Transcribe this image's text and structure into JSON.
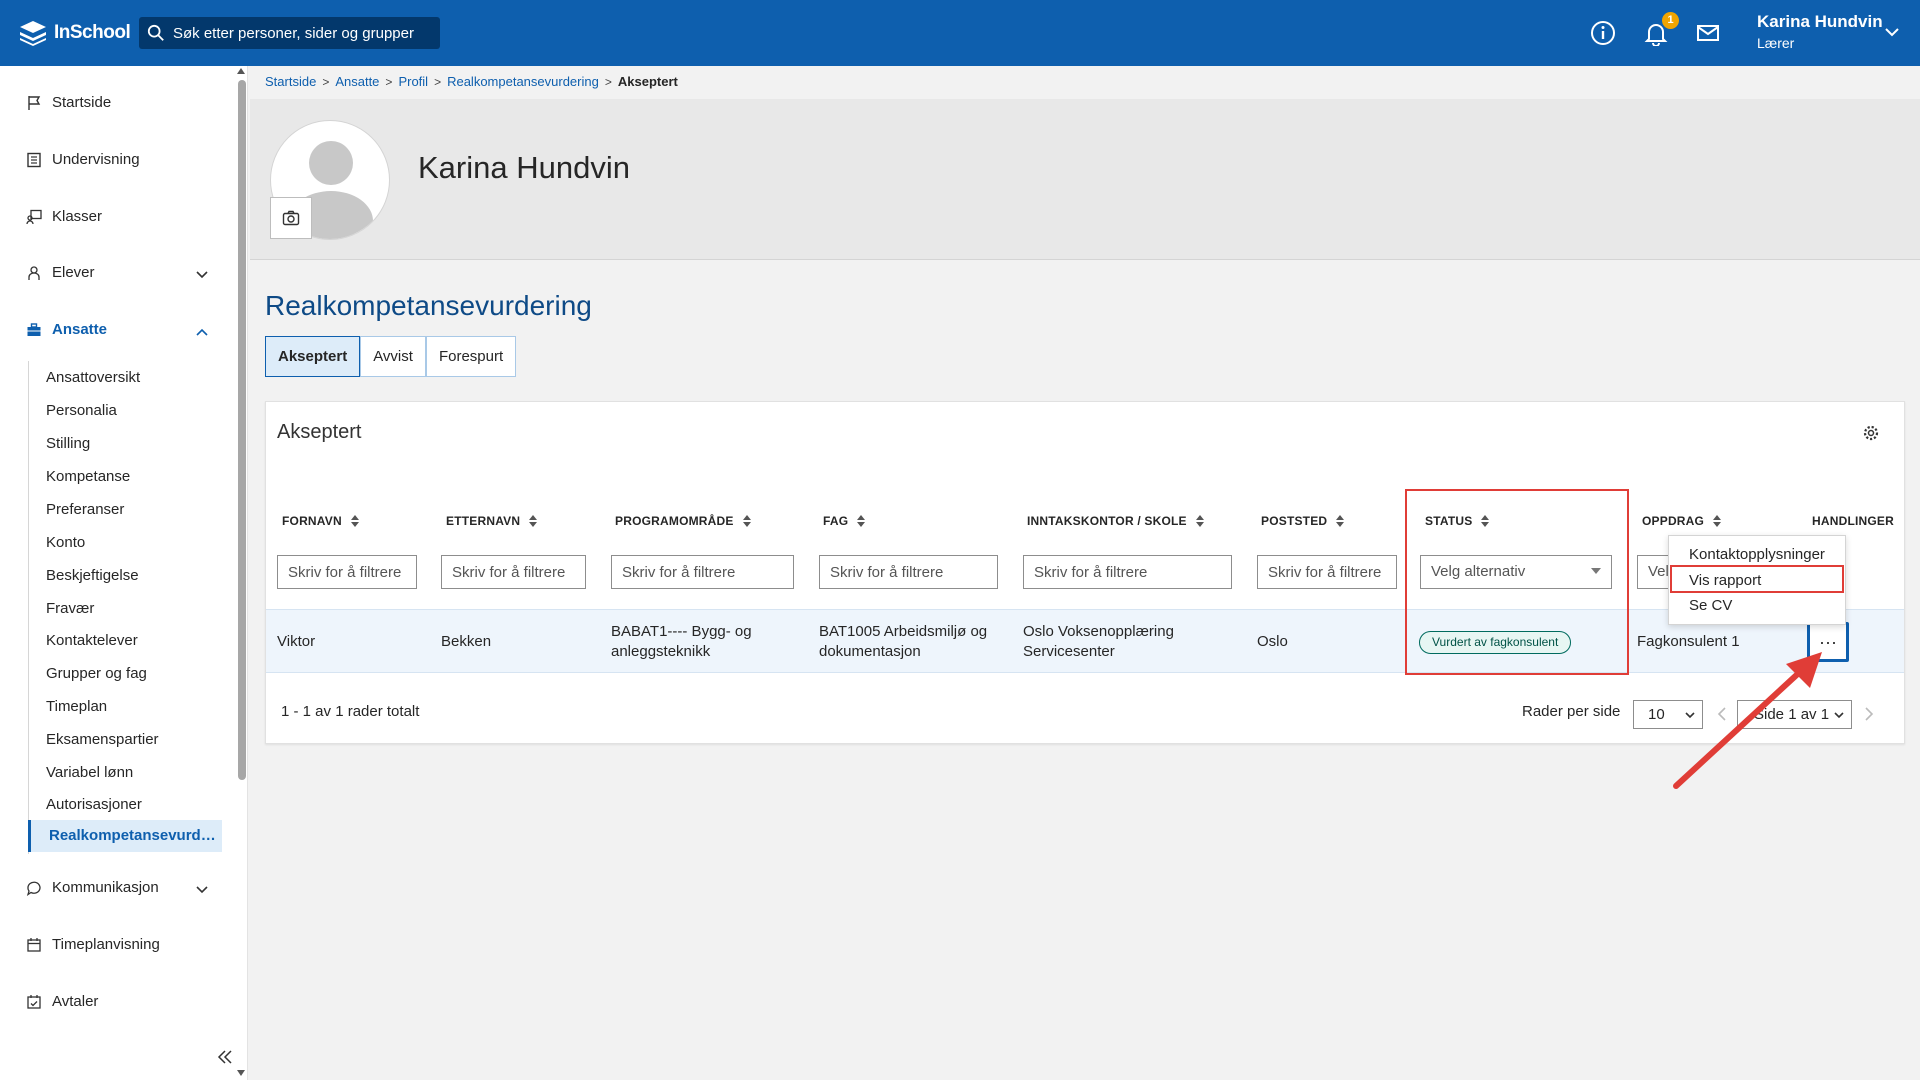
{
  "app": {
    "logo_text": "InSchool",
    "brand_color": "#0e5fae"
  },
  "search": {
    "placeholder": "Søk etter personer, sider og grupper"
  },
  "header": {
    "notification_count": "1",
    "user_name": "Karina Hundvin",
    "user_role": "Lærer"
  },
  "sidebar": {
    "items": [
      {
        "label": "Startside",
        "icon": "flag-icon"
      },
      {
        "label": "Undervisning",
        "icon": "book-icon"
      },
      {
        "label": "Klasser",
        "icon": "classroom-icon"
      },
      {
        "label": "Elever",
        "icon": "students-icon"
      },
      {
        "label": "Ansatte",
        "icon": "briefcase-icon"
      },
      {
        "label": "Kommunikasjon",
        "icon": "chat-icon"
      },
      {
        "label": "Timeplanvisning",
        "icon": "calendar-icon"
      },
      {
        "label": "Avtaler",
        "icon": "calendar-check-icon"
      }
    ],
    "ansatte_sub": [
      "Ansattoversikt",
      "Personalia",
      "Stilling",
      "Kompetanse",
      "Preferanser",
      "Konto",
      "Beskjeftigelse",
      "Fravær",
      "Kontaktelever",
      "Grupper og fag",
      "Timeplan",
      "Eksamenspartier",
      "Variabel lønn",
      "Autorisasjoner",
      "Realkompetansevurdering"
    ]
  },
  "breadcrumb": {
    "items": [
      "Startside",
      "Ansatte",
      "Profil",
      "Realkompetansevurdering"
    ],
    "current": "Akseptert"
  },
  "profile": {
    "name": "Karina Hundvin"
  },
  "page": {
    "title": "Realkompetansevurdering",
    "tabs": [
      "Akseptert",
      "Avvist",
      "Forespurt"
    ],
    "card_title": "Akseptert"
  },
  "table": {
    "headers": [
      "FORNAVN",
      "ETTERNAVN",
      "PROGRAMOMRÅDE",
      "FAG",
      "INNTAKSKONTOR / SKOLE",
      "POSTSTED",
      "STATUS",
      "OPPDRAG",
      "HANDLINGER"
    ],
    "filter_placeholder": "Skriv for å filtrere",
    "select_placeholder": "Velg alternativ",
    "oppdrag_select_partial": "Vel",
    "rows": [
      {
        "fornavn": "Viktor",
        "etternavn": "Bekken",
        "programomrade": "BABAT1---- Bygg- og anleggsteknikk",
        "fag": "BAT1005 Arbeidsmiljø og dokumentasjon",
        "skole": "Oslo Voksenopplæring Servicesenter",
        "poststed": "Oslo",
        "status": "Vurdert av fagkonsulent",
        "oppdrag": "Fagkonsulent 1",
        "more": "···"
      }
    ],
    "footer": "1 - 1 av 1 rader totalt",
    "rows_per_page_label": "Rader per side",
    "rows_per_page": "10",
    "page_label": "Side 1 av 1"
  },
  "actions_menu": {
    "items": [
      "Kontaktopplysninger",
      "Vis rapport",
      "Se CV"
    ]
  },
  "colors": {
    "highlight": "#e03d37",
    "status_green": "#006b5e"
  }
}
